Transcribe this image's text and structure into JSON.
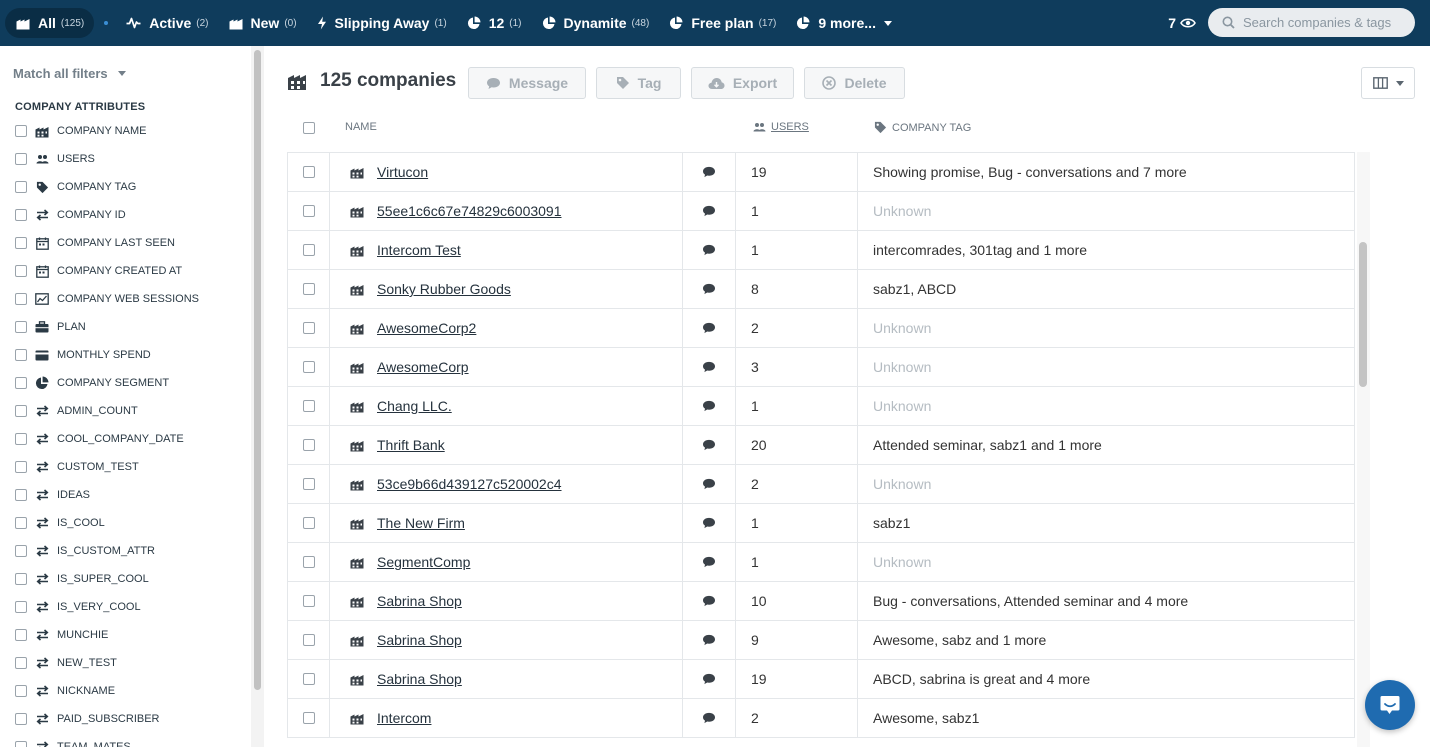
{
  "topbar": {
    "segments": [
      {
        "label": "All",
        "count": "(125)",
        "icon": "building-icon"
      },
      {
        "label": "Active",
        "count": "(2)",
        "icon": "activity-icon"
      },
      {
        "label": "New",
        "count": "(0)",
        "icon": "building-icon"
      },
      {
        "label": "Slipping Away",
        "count": "(1)",
        "icon": "bolt-icon"
      },
      {
        "label": "12",
        "count": "(1)",
        "icon": "pie-icon"
      },
      {
        "label": "Dynamite",
        "count": "(48)",
        "icon": "pie-icon"
      },
      {
        "label": "Free plan",
        "count": "(17)",
        "icon": "pie-icon"
      },
      {
        "label": "9 more...",
        "count": "",
        "icon": "pie-icon"
      }
    ],
    "viewers_count": "7",
    "search_placeholder": "Search companies & tags"
  },
  "sidebar": {
    "match_label": "Match all filters",
    "section_title": "COMPANY ATTRIBUTES",
    "attributes": [
      {
        "label": "COMPANY NAME",
        "icon": "building-icon"
      },
      {
        "label": "USERS",
        "icon": "users-icon"
      },
      {
        "label": "COMPANY TAG",
        "icon": "tag-icon"
      },
      {
        "label": "COMPANY ID",
        "icon": "arrows-icon"
      },
      {
        "label": "COMPANY LAST SEEN",
        "icon": "calendar-icon"
      },
      {
        "label": "COMPANY CREATED AT",
        "icon": "calendar-icon"
      },
      {
        "label": "COMPANY WEB SESSIONS",
        "icon": "chart-icon"
      },
      {
        "label": "PLAN",
        "icon": "briefcase-icon"
      },
      {
        "label": "MONTHLY SPEND",
        "icon": "card-icon"
      },
      {
        "label": "COMPANY SEGMENT",
        "icon": "pie-icon"
      },
      {
        "label": "ADMIN_COUNT",
        "icon": "arrows-icon"
      },
      {
        "label": "COOL_COMPANY_DATE",
        "icon": "arrows-icon"
      },
      {
        "label": "CUSTOM_TEST",
        "icon": "arrows-icon"
      },
      {
        "label": "IDEAS",
        "icon": "arrows-icon"
      },
      {
        "label": "IS_COOL",
        "icon": "arrows-icon"
      },
      {
        "label": "IS_CUSTOM_ATTR",
        "icon": "arrows-icon"
      },
      {
        "label": "IS_SUPER_COOL",
        "icon": "arrows-icon"
      },
      {
        "label": "IS_VERY_COOL",
        "icon": "arrows-icon"
      },
      {
        "label": "MUNCHIE",
        "icon": "arrows-icon"
      },
      {
        "label": "NEW_TEST",
        "icon": "arrows-icon"
      },
      {
        "label": "NICKNAME",
        "icon": "arrows-icon"
      },
      {
        "label": "PAID_SUBSCRIBER",
        "icon": "arrows-icon"
      },
      {
        "label": "TEAM_MATES",
        "icon": "arrows-icon"
      }
    ]
  },
  "main": {
    "title": "125 companies",
    "actions": {
      "message": "Message",
      "tag": "Tag",
      "export": "Export",
      "delete": "Delete"
    },
    "columns": {
      "name": "NAME",
      "users": "USERS",
      "tag": "COMPANY TAG"
    },
    "rows": [
      {
        "name": "Virtucon",
        "users": "19",
        "tags": "Showing promise, Bug - conversations and 7 more",
        "unknown": false
      },
      {
        "name": "55ee1c6c67e74829c6003091",
        "users": "1",
        "tags": "Unknown",
        "unknown": true
      },
      {
        "name": "Intercom Test",
        "users": "1",
        "tags": "intercomrades, 301tag and 1 more",
        "unknown": false
      },
      {
        "name": "Sonky Rubber Goods",
        "users": "8",
        "tags": "sabz1, ABCD",
        "unknown": false
      },
      {
        "name": "AwesomeCorp2",
        "users": "2",
        "tags": "Unknown",
        "unknown": true
      },
      {
        "name": "AwesomeCorp",
        "users": "3",
        "tags": "Unknown",
        "unknown": true
      },
      {
        "name": "Chang LLC.",
        "users": "1",
        "tags": "Unknown",
        "unknown": true
      },
      {
        "name": "Thrift Bank",
        "users": "20",
        "tags": "Attended seminar, sabz1 and 1 more",
        "unknown": false
      },
      {
        "name": "53ce9b66d439127c520002c4",
        "users": "2",
        "tags": "Unknown",
        "unknown": true
      },
      {
        "name": "The New Firm",
        "users": "1",
        "tags": "sabz1",
        "unknown": false
      },
      {
        "name": "SegmentComp",
        "users": "1",
        "tags": "Unknown",
        "unknown": true
      },
      {
        "name": "Sabrina Shop",
        "users": "10",
        "tags": "Bug - conversations, Attended seminar and 4 more",
        "unknown": false
      },
      {
        "name": "Sabrina Shop",
        "users": "9",
        "tags": "Awesome, sabz and 1 more",
        "unknown": false
      },
      {
        "name": "Sabrina Shop",
        "users": "19",
        "tags": "ABCD, sabrina is great and 4 more",
        "unknown": false
      },
      {
        "name": "Intercom",
        "users": "2",
        "tags": "Awesome, sabz1",
        "unknown": false
      }
    ]
  },
  "colors": {
    "topbar": "#0f3c5c",
    "accent": "#1f6bb0",
    "unknown_text": "#b5bcc2"
  }
}
